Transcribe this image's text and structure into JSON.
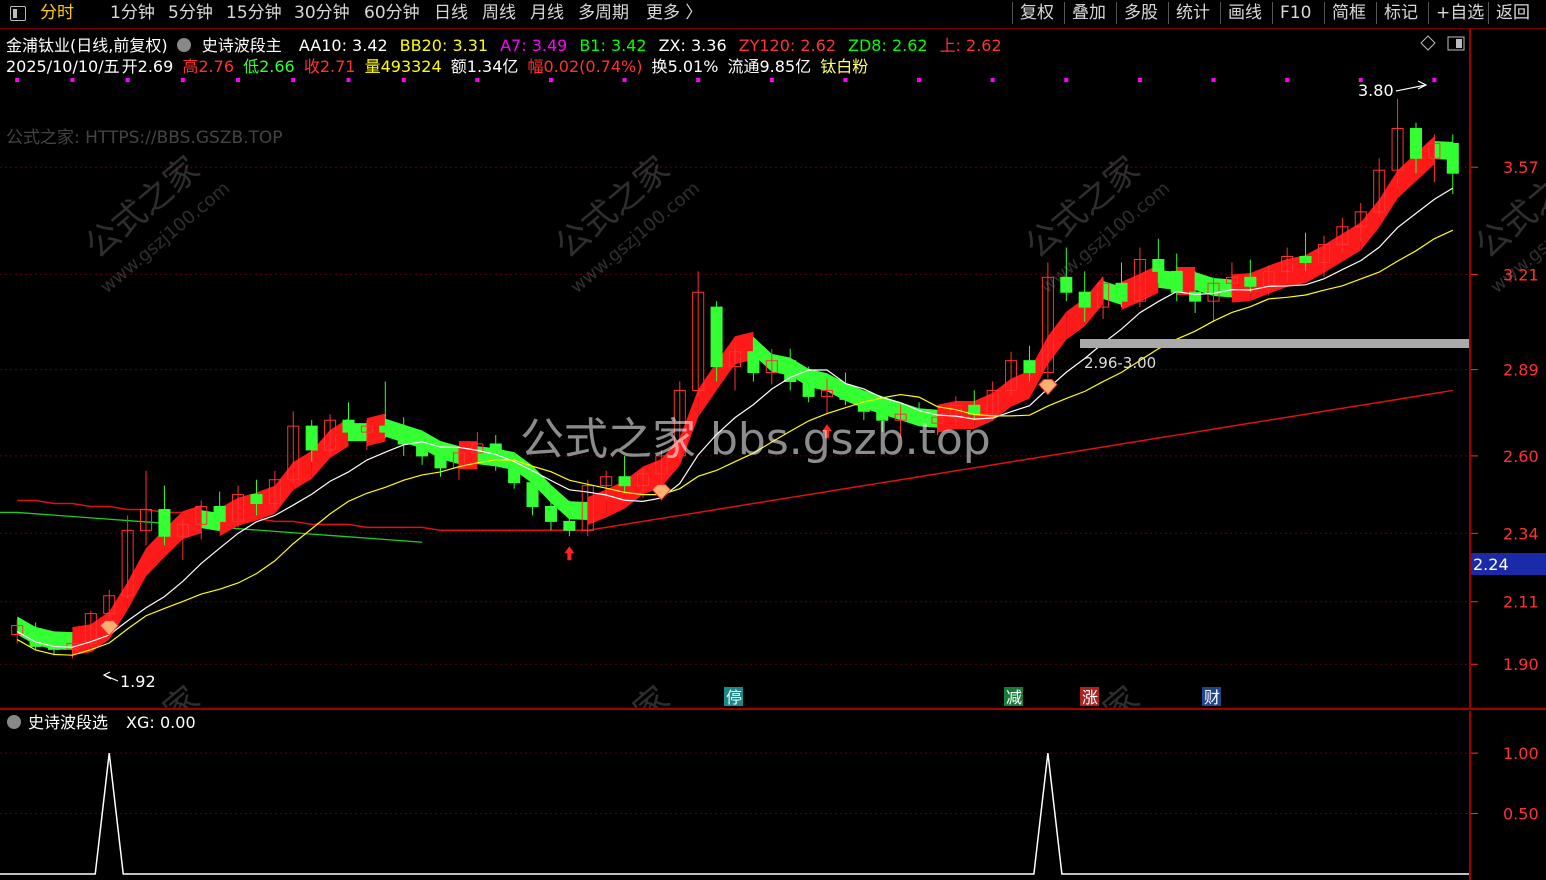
{
  "toolbar": {
    "left": [
      "分时",
      "1分钟",
      "5分钟",
      "15分钟",
      "30分钟",
      "60分钟",
      "日线",
      "周线",
      "月线",
      "多周期",
      "更多 〉"
    ],
    "active": "分时",
    "right": [
      "复权",
      "叠加",
      "多股",
      "统计",
      "画线",
      "F10",
      "简框",
      "标记",
      "+自选",
      "返回"
    ]
  },
  "stock": {
    "name": "金浦钛业(日线,前复权)",
    "indicator_name": "史诗波段主",
    "params": [
      {
        "label": "AA10:",
        "value": "3.42",
        "color": "#ffffff"
      },
      {
        "label": "BB20:",
        "value": "3.31",
        "color": "#ffff00"
      },
      {
        "label": "A7:",
        "value": "3.49",
        "color": "#ff00ff"
      },
      {
        "label": "B1:",
        "value": "3.42",
        "color": "#00ff00"
      },
      {
        "label": "ZX:",
        "value": "3.36",
        "color": "#ffffff"
      },
      {
        "label": "ZY120:",
        "value": "2.62",
        "color": "#ff3333"
      },
      {
        "label": "ZD8:",
        "value": "2.62",
        "color": "#00ff00"
      },
      {
        "label": "上:",
        "value": "2.62",
        "color": "#ff3333"
      }
    ]
  },
  "quote": {
    "date": "2025/10/10/五",
    "open_label": "开",
    "open": "2.69",
    "high_label": "高",
    "high": "2.76",
    "low_label": "低",
    "low": "2.66",
    "close_label": "收",
    "close": "2.71",
    "vol_label": "量",
    "vol": "493324",
    "amount_label": "额",
    "amount": "1.34亿",
    "change_label": "幅",
    "change": "0.02(0.74%)",
    "turnover_label": "换",
    "turnover": "5.01%",
    "float_label": "流通",
    "float": "9.85亿",
    "sector": "钛白粉"
  },
  "watermark_text": "公式之家: HTTPS://BBS.GSZB.TOP",
  "center_watermark": "公式之家 bbs.gszb.top",
  "diag_watermarks": [
    "公式之家",
    "www.gszj100.com"
  ],
  "annotations": {
    "high_label": "3.80",
    "low_label": "1.92",
    "zone_label": "2.96-3.00",
    "current_price": "2.24"
  },
  "price_axis": {
    "ticks": [
      "3.57",
      "3.21",
      "2.89",
      "2.60",
      "2.34",
      "2.11",
      "1.90"
    ]
  },
  "event_badges": [
    {
      "text": "停",
      "color": "#1a8a8a"
    },
    {
      "text": "减",
      "color": "#1a7a3a"
    },
    {
      "text": "涨",
      "color": "#aa2222"
    },
    {
      "text": "财",
      "color": "#224488"
    }
  ],
  "indicator": {
    "name": "史诗波段选",
    "series_label": "XG:",
    "series_value": "0.00",
    "axis_ticks": [
      "1.00",
      "0.50"
    ]
  },
  "colors": {
    "up": "#ff3232",
    "down": "#00e0e0",
    "ribbon_up": "#ff1a1a",
    "ribbon_down": "#33ff33",
    "grid": "#7a0000",
    "axis_text": "#ff3232"
  },
  "chart_data": {
    "type": "line",
    "price_ylim": [
      1.8,
      3.9
    ],
    "candles": [
      {
        "o": 2.0,
        "h": 2.05,
        "l": 1.97,
        "c": 2.03
      },
      {
        "o": 2.02,
        "h": 2.04,
        "l": 1.95,
        "c": 1.96
      },
      {
        "o": 1.97,
        "h": 2.0,
        "l": 1.93,
        "c": 1.95
      },
      {
        "o": 1.95,
        "h": 1.98,
        "l": 1.92,
        "c": 1.97
      },
      {
        "o": 1.97,
        "h": 2.08,
        "l": 1.96,
        "c": 2.07
      },
      {
        "o": 2.07,
        "h": 2.15,
        "l": 2.05,
        "c": 2.13
      },
      {
        "o": 2.13,
        "h": 2.4,
        "l": 2.12,
        "c": 2.35
      },
      {
        "o": 2.35,
        "h": 2.55,
        "l": 2.3,
        "c": 2.42
      },
      {
        "o": 2.42,
        "h": 2.5,
        "l": 2.3,
        "c": 2.33
      },
      {
        "o": 2.33,
        "h": 2.4,
        "l": 2.25,
        "c": 2.37
      },
      {
        "o": 2.37,
        "h": 2.45,
        "l": 2.32,
        "c": 2.43
      },
      {
        "o": 2.43,
        "h": 2.48,
        "l": 2.35,
        "c": 2.38
      },
      {
        "o": 2.38,
        "h": 2.5,
        "l": 2.36,
        "c": 2.47
      },
      {
        "o": 2.47,
        "h": 2.52,
        "l": 2.4,
        "c": 2.44
      },
      {
        "o": 2.44,
        "h": 2.55,
        "l": 2.42,
        "c": 2.52
      },
      {
        "o": 2.52,
        "h": 2.75,
        "l": 2.5,
        "c": 2.7
      },
      {
        "o": 2.7,
        "h": 2.72,
        "l": 2.58,
        "c": 2.62
      },
      {
        "o": 2.62,
        "h": 2.74,
        "l": 2.6,
        "c": 2.72
      },
      {
        "o": 2.72,
        "h": 2.78,
        "l": 2.65,
        "c": 2.68
      },
      {
        "o": 2.68,
        "h": 2.72,
        "l": 2.62,
        "c": 2.7
      },
      {
        "o": 2.7,
        "h": 2.85,
        "l": 2.66,
        "c": 2.68
      },
      {
        "o": 2.68,
        "h": 2.73,
        "l": 2.6,
        "c": 2.64
      },
      {
        "o": 2.64,
        "h": 2.68,
        "l": 2.57,
        "c": 2.6
      },
      {
        "o": 2.6,
        "h": 2.64,
        "l": 2.53,
        "c": 2.56
      },
      {
        "o": 2.56,
        "h": 2.63,
        "l": 2.52,
        "c": 2.61
      },
      {
        "o": 2.61,
        "h": 2.68,
        "l": 2.58,
        "c": 2.64
      },
      {
        "o": 2.64,
        "h": 2.67,
        "l": 2.55,
        "c": 2.57
      },
      {
        "o": 2.57,
        "h": 2.6,
        "l": 2.49,
        "c": 2.51
      },
      {
        "o": 2.51,
        "h": 2.55,
        "l": 2.4,
        "c": 2.43
      },
      {
        "o": 2.43,
        "h": 2.47,
        "l": 2.35,
        "c": 2.38
      },
      {
        "o": 2.38,
        "h": 2.45,
        "l": 2.33,
        "c": 2.35
      },
      {
        "o": 2.35,
        "h": 2.52,
        "l": 2.33,
        "c": 2.5
      },
      {
        "o": 2.5,
        "h": 2.55,
        "l": 2.45,
        "c": 2.53
      },
      {
        "o": 2.53,
        "h": 2.6,
        "l": 2.48,
        "c": 2.5
      },
      {
        "o": 2.5,
        "h": 2.56,
        "l": 2.46,
        "c": 2.54
      },
      {
        "o": 2.54,
        "h": 2.62,
        "l": 2.5,
        "c": 2.6
      },
      {
        "o": 2.6,
        "h": 2.85,
        "l": 2.58,
        "c": 2.82
      },
      {
        "o": 2.82,
        "h": 3.22,
        "l": 2.8,
        "c": 3.15
      },
      {
        "o": 3.1,
        "h": 3.12,
        "l": 2.85,
        "c": 2.9
      },
      {
        "o": 2.9,
        "h": 2.98,
        "l": 2.82,
        "c": 2.95
      },
      {
        "o": 2.95,
        "h": 3.0,
        "l": 2.85,
        "c": 2.88
      },
      {
        "o": 2.88,
        "h": 2.96,
        "l": 2.84,
        "c": 2.92
      },
      {
        "o": 2.92,
        "h": 2.96,
        "l": 2.82,
        "c": 2.85
      },
      {
        "o": 2.85,
        "h": 2.9,
        "l": 2.78,
        "c": 2.8
      },
      {
        "o": 2.8,
        "h": 2.86,
        "l": 2.74,
        "c": 2.82
      },
      {
        "o": 2.82,
        "h": 2.88,
        "l": 2.77,
        "c": 2.79
      },
      {
        "o": 2.79,
        "h": 2.82,
        "l": 2.72,
        "c": 2.75
      },
      {
        "o": 2.75,
        "h": 2.79,
        "l": 2.68,
        "c": 2.72
      },
      {
        "o": 2.72,
        "h": 2.77,
        "l": 2.66,
        "c": 2.74
      },
      {
        "o": 2.74,
        "h": 2.78,
        "l": 2.7,
        "c": 2.71
      },
      {
        "o": 2.71,
        "h": 2.75,
        "l": 2.67,
        "c": 2.73
      },
      {
        "o": 2.73,
        "h": 2.8,
        "l": 2.7,
        "c": 2.77
      },
      {
        "o": 2.77,
        "h": 2.82,
        "l": 2.72,
        "c": 2.74
      },
      {
        "o": 2.74,
        "h": 2.85,
        "l": 2.72,
        "c": 2.82
      },
      {
        "o": 2.82,
        "h": 2.95,
        "l": 2.8,
        "c": 2.92
      },
      {
        "o": 2.92,
        "h": 2.97,
        "l": 2.85,
        "c": 2.88
      },
      {
        "o": 2.88,
        "h": 3.25,
        "l": 2.86,
        "c": 3.2
      },
      {
        "o": 3.2,
        "h": 3.3,
        "l": 3.12,
        "c": 3.15
      },
      {
        "o": 3.15,
        "h": 3.22,
        "l": 3.05,
        "c": 3.1
      },
      {
        "o": 3.1,
        "h": 3.2,
        "l": 3.06,
        "c": 3.18
      },
      {
        "o": 3.18,
        "h": 3.25,
        "l": 3.1,
        "c": 3.12
      },
      {
        "o": 3.12,
        "h": 3.3,
        "l": 3.1,
        "c": 3.26
      },
      {
        "o": 3.26,
        "h": 3.33,
        "l": 3.18,
        "c": 3.22
      },
      {
        "o": 3.22,
        "h": 3.28,
        "l": 3.12,
        "c": 3.15
      },
      {
        "o": 3.15,
        "h": 3.22,
        "l": 3.08,
        "c": 3.12
      },
      {
        "o": 3.12,
        "h": 3.2,
        "l": 3.05,
        "c": 3.18
      },
      {
        "o": 3.18,
        "h": 3.25,
        "l": 3.14,
        "c": 3.2
      },
      {
        "o": 3.2,
        "h": 3.26,
        "l": 3.15,
        "c": 3.17
      },
      {
        "o": 3.17,
        "h": 3.24,
        "l": 3.14,
        "c": 3.22
      },
      {
        "o": 3.22,
        "h": 3.3,
        "l": 3.18,
        "c": 3.27
      },
      {
        "o": 3.27,
        "h": 3.35,
        "l": 3.22,
        "c": 3.25
      },
      {
        "o": 3.25,
        "h": 3.34,
        "l": 3.2,
        "c": 3.31
      },
      {
        "o": 3.31,
        "h": 3.4,
        "l": 3.28,
        "c": 3.37
      },
      {
        "o": 3.37,
        "h": 3.45,
        "l": 3.32,
        "c": 3.42
      },
      {
        "o": 3.42,
        "h": 3.6,
        "l": 3.4,
        "c": 3.56
      },
      {
        "o": 3.56,
        "h": 3.8,
        "l": 3.5,
        "c": 3.7
      },
      {
        "o": 3.7,
        "h": 3.72,
        "l": 3.55,
        "c": 3.6
      },
      {
        "o": 3.6,
        "h": 3.68,
        "l": 3.52,
        "c": 3.65
      },
      {
        "o": 3.65,
        "h": 3.68,
        "l": 3.48,
        "c": 3.55
      }
    ],
    "ma120": [
      2.45,
      2.45,
      2.44,
      2.44,
      2.43,
      2.43,
      2.42,
      2.42,
      2.41,
      2.41,
      2.4,
      2.4,
      2.39,
      2.39,
      2.38,
      2.38,
      2.37,
      2.37,
      2.37,
      2.36,
      2.36,
      2.36,
      2.36,
      2.35,
      2.35,
      2.35,
      2.35,
      2.35,
      2.35,
      2.35,
      2.35,
      2.35,
      2.36,
      2.37,
      2.38,
      2.39,
      2.4,
      2.41,
      2.42,
      2.43,
      2.44,
      2.45,
      2.46,
      2.47,
      2.48,
      2.49,
      2.5,
      2.51,
      2.52,
      2.53,
      2.54,
      2.55,
      2.56,
      2.57,
      2.58,
      2.59,
      2.6,
      2.61,
      2.62,
      2.63,
      2.64,
      2.65,
      2.66,
      2.67,
      2.68,
      2.69,
      2.7,
      2.71,
      2.72,
      2.73,
      2.74,
      2.75,
      2.76,
      2.77,
      2.78,
      2.79,
      2.8,
      2.81,
      2.82
    ],
    "xg_signal_indices": [
      5,
      56
    ],
    "indicator_ylim": [
      0,
      1.1
    ]
  }
}
